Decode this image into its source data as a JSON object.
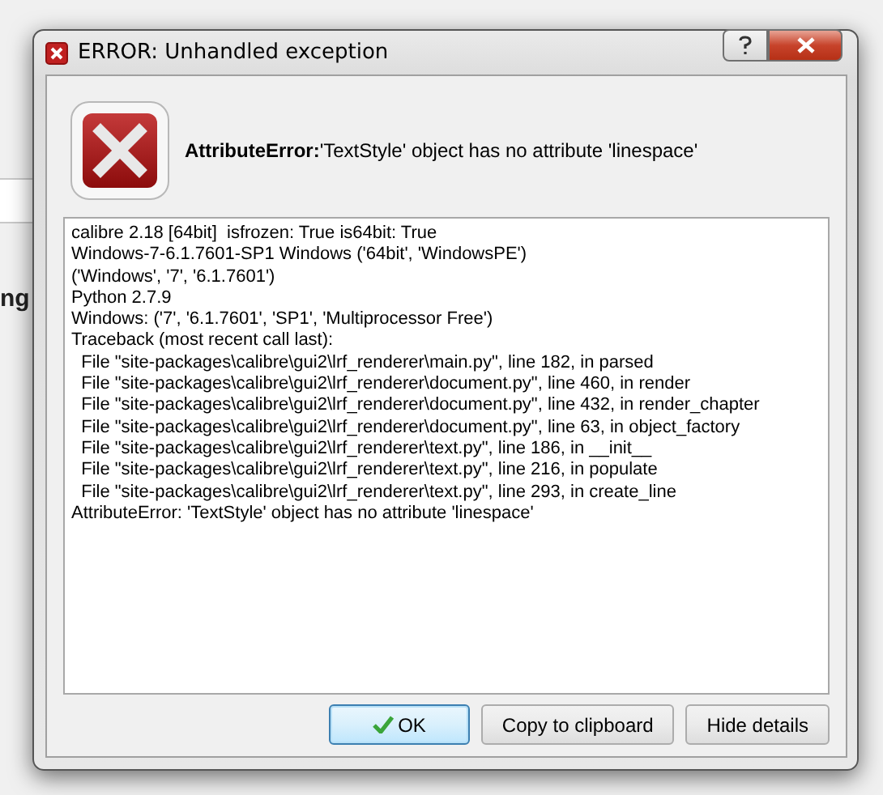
{
  "background_app": {
    "heading": "ng"
  },
  "window": {
    "title": "ERROR: Unhandled exception"
  },
  "message": {
    "error_type": "AttributeError:",
    "text": "'TextStyle' object has no attribute 'linespace'"
  },
  "details": [
    "calibre 2.18 [64bit]  isfrozen: True is64bit: True",
    "Windows-7-6.1.7601-SP1 Windows ('64bit', 'WindowsPE')",
    "('Windows', '7', '6.1.7601')",
    "Python 2.7.9",
    "Windows: ('7', '6.1.7601', 'SP1', 'Multiprocessor Free')",
    "Traceback (most recent call last):",
    "  File \"site-packages\\calibre\\gui2\\lrf_renderer\\main.py\", line 182, in parsed",
    "  File \"site-packages\\calibre\\gui2\\lrf_renderer\\document.py\", line 460, in render",
    "  File \"site-packages\\calibre\\gui2\\lrf_renderer\\document.py\", line 432, in render_chapter",
    "  File \"site-packages\\calibre\\gui2\\lrf_renderer\\document.py\", line 63, in object_factory",
    "  File \"site-packages\\calibre\\gui2\\lrf_renderer\\text.py\", line 186, in __init__",
    "  File \"site-packages\\calibre\\gui2\\lrf_renderer\\text.py\", line 216, in populate",
    "  File \"site-packages\\calibre\\gui2\\lrf_renderer\\text.py\", line 293, in create_line",
    "AttributeError: 'TextStyle' object has no attribute 'linespace'"
  ],
  "buttons": [
    {
      "label": "OK",
      "kind": "ok",
      "selected": true
    },
    {
      "label": "Copy to clipboard",
      "kind": "plain",
      "selected": false
    },
    {
      "label": "Hide details",
      "kind": "plain",
      "selected": false
    }
  ]
}
